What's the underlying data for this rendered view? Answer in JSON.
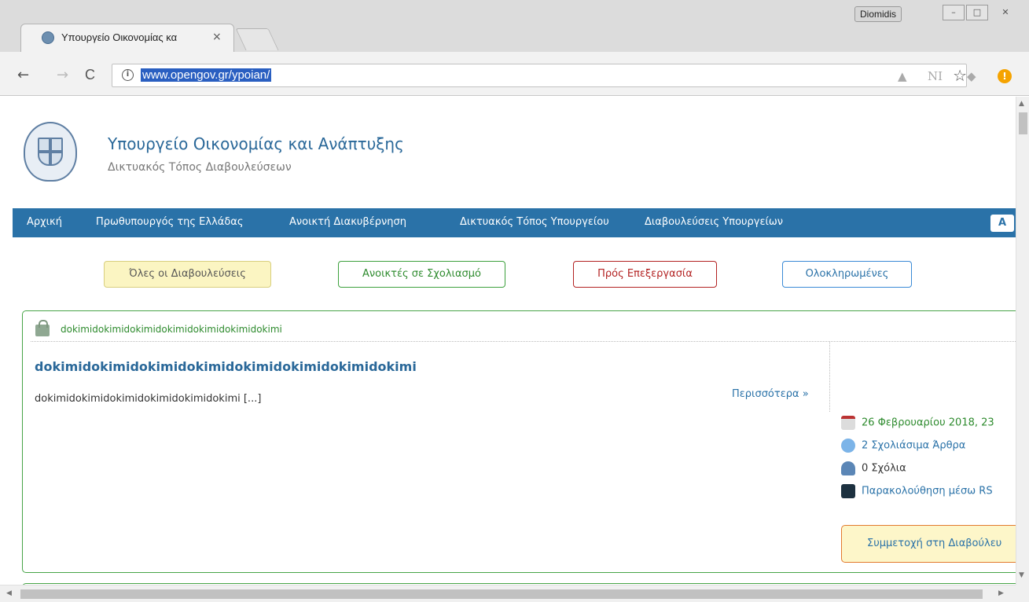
{
  "window": {
    "user": "Diomidis",
    "minimize": "–",
    "maximize": "□",
    "close": "✕"
  },
  "tab": {
    "title": "Υπουργείο Οικονομίας κα",
    "close": "×"
  },
  "toolbar": {
    "back": "←",
    "forward": "→",
    "reload": "C",
    "info": "i",
    "url": "www.opengov.gr/ypoian/",
    "bookmark": "☆",
    "ext_drive": "▲",
    "ext_ni": "NI",
    "ext_puzzle": "◆",
    "ext_warn": "!"
  },
  "site": {
    "title": "Υπουργείο Οικονομίας και Ανάπτυξης",
    "subtitle": "Δικτυακός Τόπος Διαβουλεύσεων"
  },
  "menu": {
    "items": [
      "Αρχική",
      "Πρωθυπουργός της Ελλάδας",
      "Ανοικτή Διακυβέρνηση",
      "Δικτυακός Τόπος Υπουργείου",
      "Διαβουλεύσεις Υπουργείων"
    ],
    "accessibility": "A"
  },
  "filters": {
    "all": "Όλες οι Διαβουλεύσεις",
    "open": "Ανοικτές σε Σχολιασμό",
    "processing": "Πρός Επεξεργασία",
    "completed": "Ολοκληρωμένες"
  },
  "consultation": {
    "ministry": "dokimidokimidokimidokimidokimidokimidokimi",
    "title": "dokimidokimidokimidokimidokimidokimidokimidokimi",
    "description": "dokimidokimidokimidokimidokimidokimi [...]",
    "more": "Περισσότερα »",
    "date": "26 Φεβρουαρίου 2018, 23",
    "articles": "2 Σχολιάσιμα Άρθρα",
    "comments": "0 Σχόλια",
    "rss": "Παρακολούθηση μέσω RS",
    "participate": "Συμμετοχή στη Διαβούλευ"
  },
  "colors": {
    "menu_bg": "#2a72a8",
    "title_blue": "#2a6899",
    "open_green": "#2e8b2e",
    "processing_red": "#b32222",
    "participate_border": "#e27a2e"
  }
}
